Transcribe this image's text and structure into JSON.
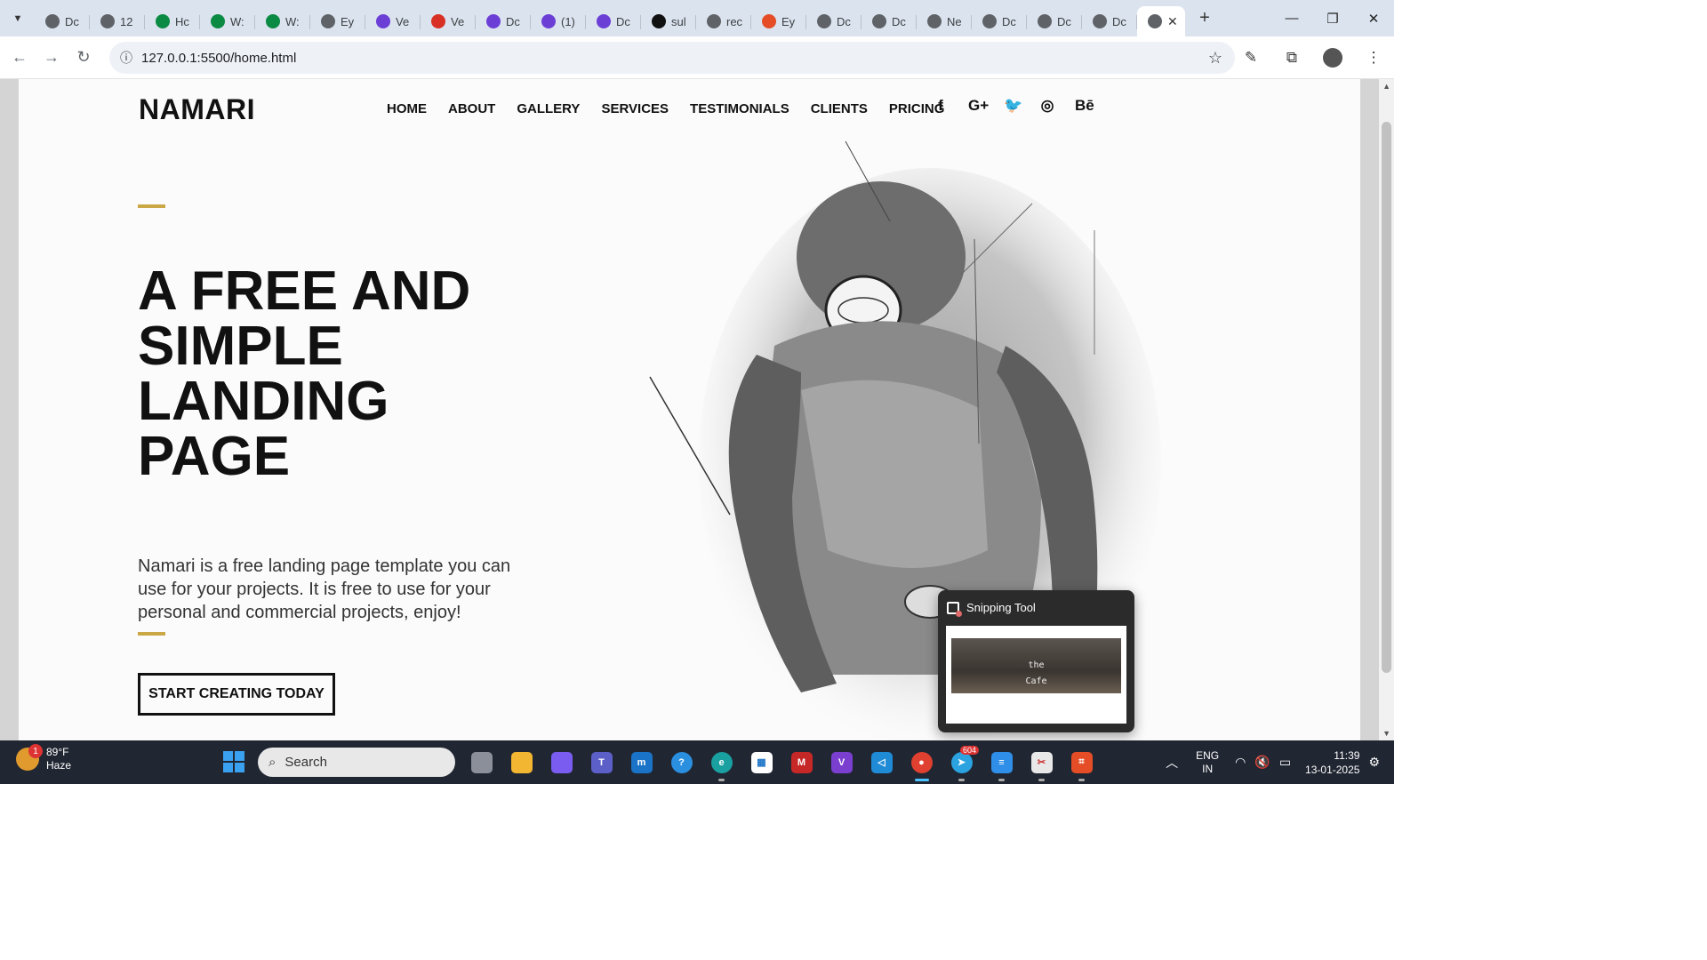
{
  "browser": {
    "tabs": [
      {
        "label": "Dc",
        "icon": "globe-icon",
        "color": "#5f6368"
      },
      {
        "label": "12",
        "icon": "globe-icon",
        "color": "#5f6368"
      },
      {
        "label": "Hc",
        "icon": "wix-icon",
        "color": "#0a8a43"
      },
      {
        "label": "W:",
        "icon": "wix-icon",
        "color": "#0a8a43"
      },
      {
        "label": "W:",
        "icon": "wix-icon",
        "color": "#0a8a43"
      },
      {
        "label": "Ey",
        "icon": "globe-icon",
        "color": "#5f6368"
      },
      {
        "label": "Ve",
        "icon": "infinity-icon",
        "color": "#6b3fd6"
      },
      {
        "label": "Ve",
        "icon": "gmail-icon",
        "color": "#d93025"
      },
      {
        "label": "Dc",
        "icon": "infinity-icon",
        "color": "#6b3fd6"
      },
      {
        "label": "(1)",
        "icon": "infinity-icon",
        "color": "#6b3fd6"
      },
      {
        "label": "Dc",
        "icon": "infinity-icon",
        "color": "#6b3fd6"
      },
      {
        "label": "sul",
        "icon": "sp-icon",
        "color": "#111111"
      },
      {
        "label": "rec",
        "icon": "globe-icon",
        "color": "#5f6368"
      },
      {
        "label": "Ey",
        "icon": "html5-icon",
        "color": "#e44d26"
      },
      {
        "label": "Dc",
        "icon": "globe-icon",
        "color": "#5f6368"
      },
      {
        "label": "Dc",
        "icon": "globe-icon",
        "color": "#5f6368"
      },
      {
        "label": "Ne",
        "icon": "globe-icon",
        "color": "#5f6368"
      },
      {
        "label": "Dc",
        "icon": "globe-icon",
        "color": "#5f6368"
      },
      {
        "label": "Dc",
        "icon": "globe-icon",
        "color": "#5f6368"
      },
      {
        "label": "Dc",
        "icon": "globe-icon",
        "color": "#5f6368"
      }
    ],
    "active_tab_close": "✕",
    "new_tab": "+",
    "url": "127.0.0.1:5500/home.html"
  },
  "site": {
    "logo": "NAMARI",
    "nav": [
      "HOME",
      "ABOUT",
      "GALLERY",
      "SERVICES",
      "TESTIMONIALS",
      "CLIENTS",
      "PRICING"
    ],
    "social": [
      {
        "name": "facebook-icon",
        "glyph": "f"
      },
      {
        "name": "google-plus-icon",
        "glyph": "G+"
      },
      {
        "name": "twitter-icon",
        "glyph": "🐦"
      },
      {
        "name": "instagram-icon",
        "glyph": "◎"
      },
      {
        "name": "behance-icon",
        "glyph": "Bē"
      }
    ],
    "headline": [
      "A FREE AND",
      "SIMPLE",
      "LANDING",
      "PAGE"
    ],
    "description": "Namari is a free landing page template you can use for your projects. It is free to use for your personal and commercial projects, enjoy!",
    "cta": "START CREATING TODAY",
    "accent_color": "#c9a845"
  },
  "snipping_tool": {
    "title": "Snipping Tool",
    "thumbnail_caption_line1": "the",
    "thumbnail_caption_line2": "Cafe"
  },
  "taskbar": {
    "weather_temp": "89°F",
    "weather_desc": "Haze",
    "weather_badge": "1",
    "search_placeholder": "Search",
    "telegram_badge": "604",
    "lang_line1": "ENG",
    "lang_line2": "IN",
    "time": "11:39",
    "date": "13-01-2025"
  }
}
